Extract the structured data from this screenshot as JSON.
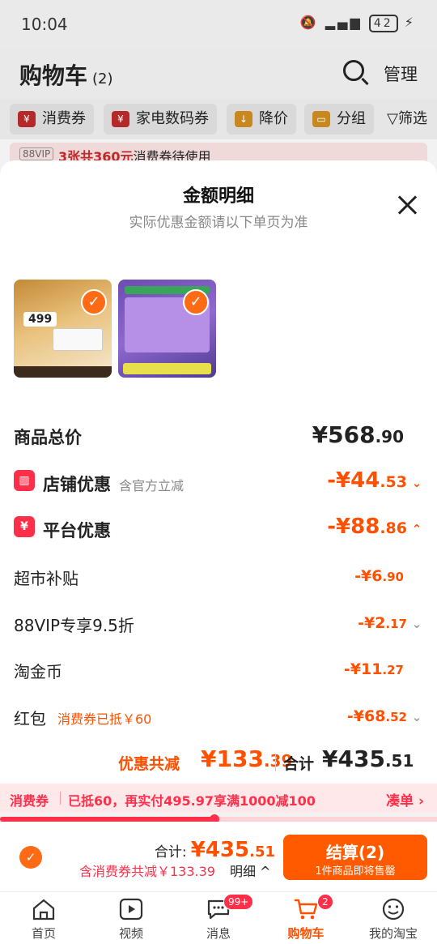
{
  "status_bar": {
    "time": "10:04",
    "battery": "42"
  },
  "header": {
    "title": "购物车",
    "count": "(2)",
    "manage": "管理"
  },
  "chips": [
    {
      "label": "消费券"
    },
    {
      "label": "家电数码券"
    },
    {
      "label": "降价"
    },
    {
      "label": "分组"
    }
  ],
  "filter_label": "筛选",
  "vip_banner": {
    "tag": "88VIP",
    "highlight": "3张共360元",
    "text": "消费券待使用"
  },
  "sheet": {
    "title": "金额明细",
    "subtitle": "实际优惠金额请以下单页为准",
    "thumb1_price": "499",
    "rows": {
      "total": {
        "label": "商品总价",
        "yen": "¥",
        "int": "568",
        "cents": ".90"
      },
      "store": {
        "label": "店铺优惠",
        "note": "含官方立减",
        "prefix": "-¥",
        "int": "44",
        "cents": ".53"
      },
      "platform": {
        "label": "平台优惠",
        "prefix": "-¥",
        "int": "88",
        "cents": ".86"
      },
      "supermarket": {
        "label": "超市补贴",
        "prefix": "-¥",
        "int": "6",
        "cents": ".90"
      },
      "vip": {
        "label": "88VIP专享9.5折",
        "prefix": "-¥",
        "int": "2",
        "cents": ".17"
      },
      "coin": {
        "label": "淘金币",
        "prefix": "-¥",
        "int": "11",
        "cents": ".27"
      },
      "redpacket": {
        "label": "红包",
        "note": "消费券已抵￥60",
        "prefix": "-¥",
        "int": "68",
        "cents": ".52"
      }
    },
    "summary": {
      "disc_label": "优惠共减",
      "disc_yen": "¥",
      "disc_int": "133",
      "disc_cents": ".39",
      "total_label": "合计",
      "total_yen": "¥",
      "total_int": "435",
      "total_cents": ".51"
    }
  },
  "coupon_bar": {
    "label": "消费券",
    "text": "已抵60，再实付495.97享满1000减100",
    "link": "凑单 ›",
    "progress": 0.49
  },
  "checkout": {
    "total_label": "合计:",
    "total_yen": "¥",
    "total_int": "435",
    "total_cents": ".51",
    "discount_text": "含消费券共减￥133.39",
    "detail": "明细 ^",
    "button_label": "结算(2)",
    "button_sub": "1件商品即将售罄"
  },
  "tabbar": [
    {
      "label": "首页",
      "icon": "home-icon"
    },
    {
      "label": "视频",
      "icon": "video-icon"
    },
    {
      "label": "消息",
      "icon": "message-icon",
      "badge": "99+"
    },
    {
      "label": "购物车",
      "icon": "cart-icon",
      "badge": "2",
      "active": true
    },
    {
      "label": "我的淘宝",
      "icon": "profile-icon"
    }
  ],
  "colors": {
    "accent": "#ff5000",
    "red": "#ff2f4a",
    "check": "#ff6a14"
  }
}
